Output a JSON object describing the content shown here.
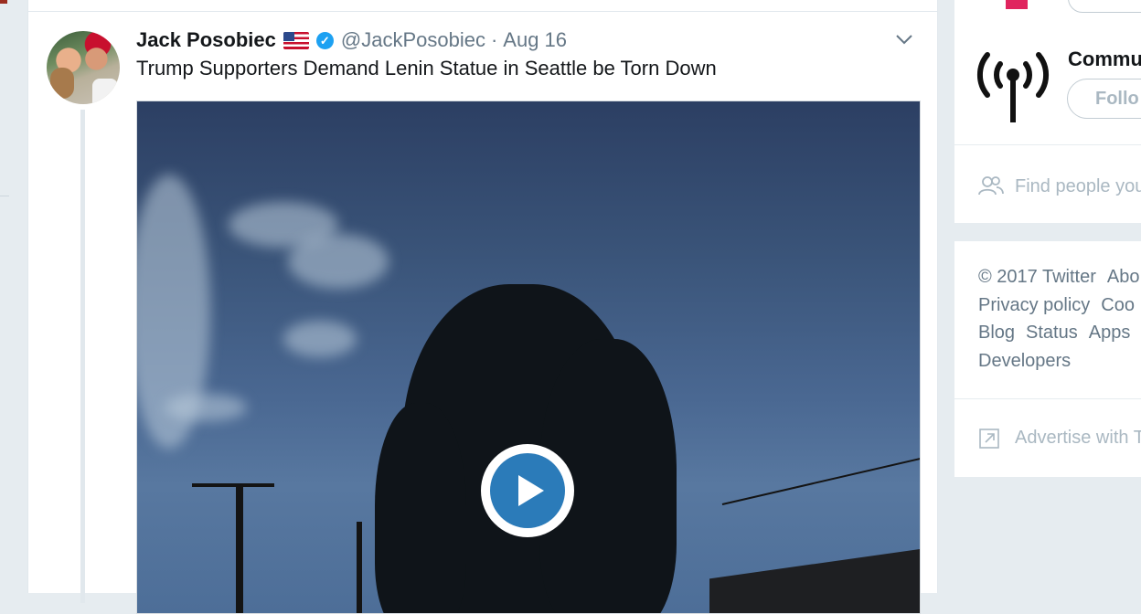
{
  "tweet": {
    "author_name": "Jack Posobiec",
    "handle": "@JackPosobiec",
    "separator": "·",
    "date": "Aug 16",
    "text": "Trump Supporters Demand Lenin Statue in Seattle be Torn Down",
    "verified_mark": "✓"
  },
  "sidebar": {
    "community": {
      "name_partial": "Commu",
      "follow_label_partial": "Follo"
    },
    "find_people_partial": "Find people you",
    "footer": {
      "row1": [
        "© 2017 Twitter",
        "Abo"
      ],
      "row2": [
        "Privacy policy",
        "Coo"
      ],
      "row3": [
        "Blog",
        "Status",
        "Apps"
      ],
      "row4": [
        "Developers"
      ]
    },
    "advertise_partial": "Advertise with T"
  },
  "colors": {
    "verified_blue": "#1da1f2",
    "play_blue": "#2b7bb9",
    "secondary_text": "#657786",
    "muted_text": "#aab8c2",
    "background": "#e6ecf0"
  },
  "icons": {
    "caret": "chevron-down-icon",
    "flag": "us-flag-emoji",
    "verified": "verified-badge-icon",
    "play": "play-icon",
    "broadcast": "broadcast-antenna-icon",
    "find_people": "people-icon",
    "advertise": "external-link-icon"
  }
}
